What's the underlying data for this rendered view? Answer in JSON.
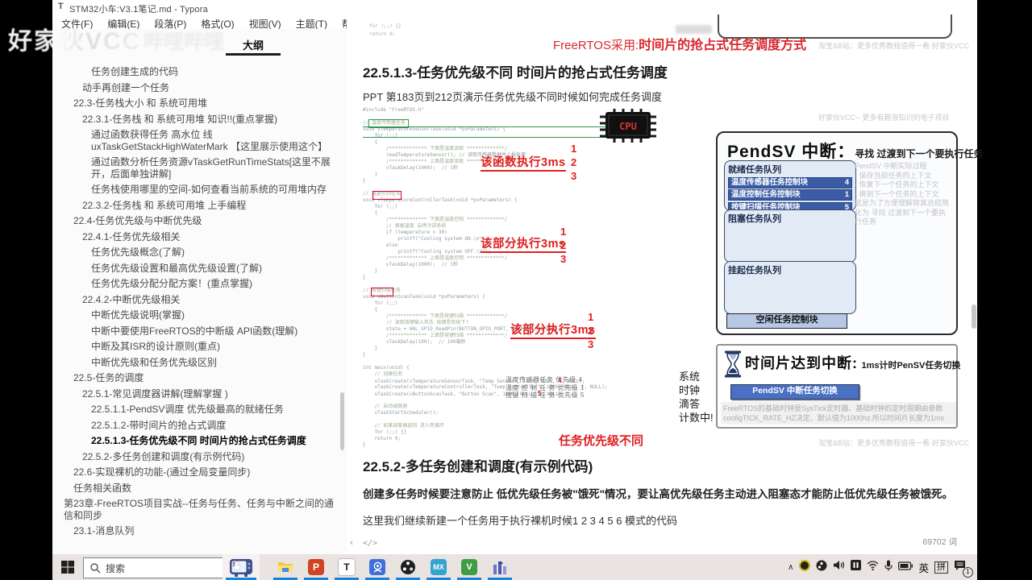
{
  "window": {
    "app_initial": "T",
    "title": "STM32小车:V3.1笔记.md - Typora",
    "controls": {
      "minimize": "–",
      "maximize": "□",
      "close": "×"
    },
    "menu": [
      "文件(F)",
      "编辑(E)",
      "段落(P)",
      "格式(O)",
      "视图(V)",
      "主题(T)",
      "帮助(H)"
    ]
  },
  "watermarks": {
    "corner": "好家伙VCC",
    "corner_ghost": "哔哩哔哩",
    "top": "淘宝&B站：更多优秀教程值得一看-好家伙VCC",
    "image_side": "好家伙VCC-- 更多有趣涨知识的电子项目",
    "bottom": "淘宝&B站：更多优秀教程值得一看-好家伙VCC"
  },
  "sidebar": {
    "tab": "大纲",
    "items": [
      {
        "t": "任务创建生成的代码",
        "lvl": 3
      },
      {
        "t": "动手再创建一个任务",
        "lvl": 2
      },
      {
        "t": "22.3-任务栈大小 和 系统可用堆",
        "lvl": 1
      },
      {
        "t": "22.3.1-任务栈 和 系统可用堆 知识!!(重点掌握)",
        "lvl": 2
      },
      {
        "t": "通过函数获得任务 高水位 线 uxTaskGetStackHighWaterMark 【这里展示使用这个】",
        "lvl": 3
      },
      {
        "t": "通过函数分析任务资源vTaskGetRunTimeStats[这里不展开，后面单独讲解]",
        "lvl": 3
      },
      {
        "t": "任务栈使用哪里的空间-如何查看当前系统的可用堆内存",
        "lvl": 3
      },
      {
        "t": "22.3.2-任务栈 和 系统可用堆 上手编程",
        "lvl": 2
      },
      {
        "t": "22.4-任务优先级与中断优先级",
        "lvl": 1
      },
      {
        "t": "22.4.1-任务优先级相关",
        "lvl": 2
      },
      {
        "t": "任务优先级概念(了解)",
        "lvl": 3
      },
      {
        "t": "任务优先级设置和最高优先级设置(了解)",
        "lvl": 3
      },
      {
        "t": "任务优先级分配分配方案！(重点掌握)",
        "lvl": 3
      },
      {
        "t": "22.4.2-中断优先级相关",
        "lvl": 2
      },
      {
        "t": "中断优先级说明(掌握)",
        "lvl": 3
      },
      {
        "t": "中断中要使用FreeRTOS的中断级 API函数(理解)",
        "lvl": 3
      },
      {
        "t": "中断及其ISR的设计原则(重点)",
        "lvl": 3
      },
      {
        "t": "中断优先级和任务优先级区别",
        "lvl": 3
      },
      {
        "t": "22.5-任务的调度",
        "lvl": 1
      },
      {
        "t": "22.5.1-常见调度器讲解(理解掌握 )",
        "lvl": 2
      },
      {
        "t": "22.5.1.1-PendSV调度 优先级最高的就绪任务",
        "lvl": 3
      },
      {
        "t": "22.5.1.2-带时间片的抢占式调度",
        "lvl": 3
      },
      {
        "t": "22.5.1.3-任务优先级不同 时间片的抢占式任务调度",
        "lvl": 3,
        "bold": true
      },
      {
        "t": "22.5.2-多任务创建和调度(有示例代码)",
        "lvl": 2
      },
      {
        "t": "22.6-实现裸机的功能-(通过全局变量同步)",
        "lvl": 1
      },
      {
        "t": "任务相关函数",
        "lvl": 1
      },
      {
        "t": "第23章-FreeRTOS项目实战--任务与任务、任务与中断之间的通信和同步",
        "lvl": 0
      },
      {
        "t": "23.1-消息队列",
        "lvl": 1
      }
    ]
  },
  "content": {
    "remnant_code": "for (;;) {}\nreturn 0;",
    "banner": {
      "prefix": "FreeRTOS采用:",
      "emphasis": "时间片的抢占式任务调度方式"
    },
    "h1": "22.5.1.3-任务优先级不同 时间片的抢占式任务调度",
    "p1": "PPT 第183页到212页演示任务优先级不同时候如何完成任务调度",
    "h2": "22.5.2-多任务创建和调度(有示例代码)",
    "p_bold": "创建多任务时候要注意防止 低优先级任务被\"饿死\"情况，要让高优先级任务主动进入阻塞态才能防止低优先级任务被饿死。",
    "p2": "这里我们继续新建一个任务用于执行裸机时候1 2 3 4 5 6 模式的代码",
    "word_count": "69702 词",
    "status_icons": {
      "sidebar_toggle": "‹",
      "source_mode": "</>"
    }
  },
  "doc_image": {
    "code_lines": [
      "#include \"FreeRTOS.h\"",
      "",
      "// 温度传感器任务",
      "void vTemperatureSensorTask(void *pvParameters) {",
      "    for (;;)",
      "    {",
      "        /************* 下面是温度读取 *************/",
      "        readTemperatureSensor(); // 读取传感器数据并上报处理",
      "        /************* 上面是温度读取 *************/",
      "        vTaskDelay(1000);  // 1秒",
      "    }",
      "}",
      "",
      "// 温度控制任务",
      "void vTemperatureControllerTask(void *pvParameters) {",
      "    for (;;)",
      "    {",
      "        /************* 下面是温度控制 *************/",
      "        // 根据温度 启停冷却系统",
      "        if (temperature > 30)",
      "            printf(\"Cooling system ON.\\n\");",
      "        else",
      "            printf(\"Cooling system OFF.\\n\");",
      "        /************* 上面是温度控制 *************/",
      "        vTaskDelay(1000);  // 1秒",
      "    }",
      "}",
      "",
      "// 按键扫描任务",
      "void vButtonScanTask(void *pvParameters) {",
      "    for (;;)",
      "    {",
      "        /************* 下面是按键扫描 *************/",
      "        // 读取按键输入状态 按键是否按下?",
      "        state = HAL_GPIO_ReadPin(BUTTON_GPIO_PORT, BUTTON_GPIO_PIN);",
      "        /************* 上面是按键扫描 *************/",
      "        vTaskDelay(100);  // 100毫秒",
      "    }",
      "}",
      "",
      "int main(void) {",
      "    // 创建任务",
      "    xTaskCreate(vTemperatureSensorTask, \"Temp Sensor\", 1000, NULL, ‹4›, NULL);",
      "    xTaskCreate(vTemperatureControllerTask, \"Temp Controller\", 1000, NULL, 1, NULL);",
      "    xTaskCreate(vButtonScanTask, \"Button Scan\", 1000, NULL, ‹5›, NULL);",
      "",
      "    // 启动调度器",
      "    vTaskStartScheduler();",
      "",
      "    // 如果调度器返回 进入死循环",
      "    for (;;) {}",
      "    return 0;",
      "}"
    ],
    "chip_label": "CPU",
    "annotations": [
      "该函数执行3ms",
      "该部分执行3ms",
      "该部分执行3ms"
    ],
    "seq": [
      "1",
      "2",
      "3"
    ],
    "task_notes": [
      "温度传感器任务 优先级 4",
      "温度 控 制 任 务 优先级 1",
      "按键 扫 描 任 务 优先级 5"
    ],
    "big_red": "任务优先级不同",
    "sysclock": [
      "系统",
      "时钟",
      "滴答",
      "计数中!"
    ],
    "diagram": {
      "title": "PendSV 中断：",
      "subtitle": "寻找 过渡到下一个要执行任务",
      "ready_label": "就绪任务队列",
      "ready_rows": [
        {
          "name": "温度传感器任务控制块",
          "prio": "4"
        },
        {
          "name": "温度控制任务控制块",
          "prio": "1"
        },
        {
          "name": "按键扫描任务控制块",
          "prio": "5"
        }
      ],
      "blocked_label": "阻塞任务队列",
      "suspended_label": "挂起任务队列",
      "idle_label": "空闲任务控制块",
      "note_lines": [
        "PendSV 中断实际过程",
        "- 保存当前任务的上下文",
        "- 恢复下一个任务的上下文",
        "- 换到下一个任务的上下文",
        "这是为了方便理解将其总结简",
        "化为 寻找 过渡到下一个要执",
        "行任务"
      ]
    },
    "timer": {
      "title": "时间片达到中断:",
      "subtitle": "1ms计时PenSV任务切换",
      "button": "PendSV 中断任务切换",
      "note_lines": [
        "FreeRTOS的基础时钟是SysTick定时器、基础时钟的定时周期由参数",
        "configTICK_RATE_HZ决定、默认值为1000hz.所以时间片长度为1ms"
      ]
    }
  },
  "taskbar": {
    "search_placeholder": "搜索",
    "mx_label": "MX",
    "typora_label": "T",
    "ppt_label": "P",
    "video_label": "V",
    "tray": {
      "ime_lang": "英",
      "ime_mode": "拼",
      "badge": "1"
    }
  }
}
